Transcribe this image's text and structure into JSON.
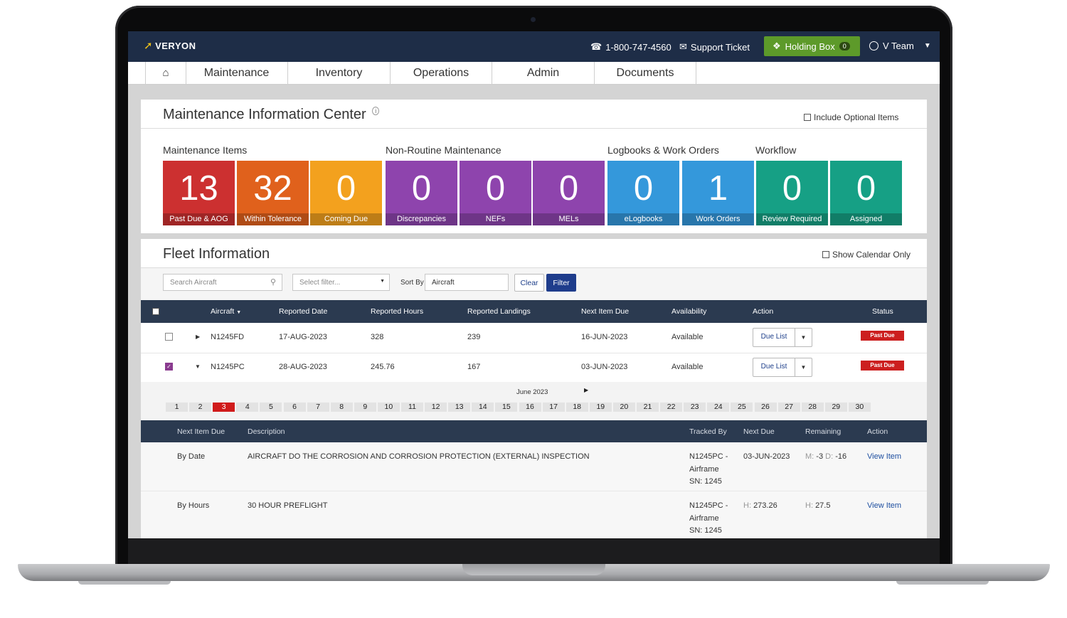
{
  "header": {
    "logo": "VERYON",
    "phone": "1-800-747-4560",
    "support": "Support Ticket",
    "holding_label": "Holding Box",
    "holding_count": "0",
    "user": "V Team"
  },
  "nav": [
    "Maintenance",
    "Inventory",
    "Operations",
    "Admin",
    "Documents"
  ],
  "mic": {
    "title": "Maintenance Information Center",
    "info": "i",
    "include_optional": "Include Optional Items",
    "sections": [
      "Maintenance Items",
      "Non-Routine Maintenance",
      "Logbooks & Work Orders",
      "Workflow"
    ],
    "tiles": [
      {
        "count": "13",
        "label": "Past Due & AOG",
        "color": "#cc3030"
      },
      {
        "count": "32",
        "label": "Within Tolerance",
        "color": "#e0611c"
      },
      {
        "count": "0",
        "label": "Coming Due",
        "color": "#f3a11e"
      },
      {
        "count": "0",
        "label": "Discrepancies",
        "color": "#8e44ad"
      },
      {
        "count": "0",
        "label": "NEFs",
        "color": "#8e44ad"
      },
      {
        "count": "0",
        "label": "MELs",
        "color": "#8e44ad"
      },
      {
        "count": "0",
        "label": "eLogbooks",
        "color": "#3498db"
      },
      {
        "count": "1",
        "label": "Work Orders",
        "color": "#3498db"
      },
      {
        "count": "0",
        "label": "Review Required",
        "color": "#16a085"
      },
      {
        "count": "0",
        "label": "Assigned",
        "color": "#16a085"
      }
    ]
  },
  "fleet": {
    "title": "Fleet Information",
    "show_calendar": "Show Calendar Only",
    "search_placeholder": "Search Aircraft",
    "filter_placeholder": "Select filter...",
    "sort_label": "Sort By",
    "sort_value": "Aircraft",
    "clear": "Clear",
    "filter": "Filter",
    "columns": [
      "Aircraft",
      "Reported Date",
      "Reported Hours",
      "Reported Landings",
      "Next Item Due",
      "Availability",
      "Action",
      "Status"
    ],
    "rows": [
      {
        "aircraft": "N1245FD",
        "date": "17-AUG-2023",
        "hours": "328",
        "landings": "239",
        "next_due": "16-JUN-2023",
        "availability": "Available",
        "action": "Due List",
        "status": "Past Due",
        "checked": false
      },
      {
        "aircraft": "N1245PC",
        "date": "28-AUG-2023",
        "hours": "245.76",
        "landings": "167",
        "next_due": "03-JUN-2023",
        "availability": "Available",
        "action": "Due List",
        "status": "Past Due",
        "checked": true
      }
    ],
    "calendar": {
      "month": "June 2023",
      "days": [
        "1",
        "2",
        "3",
        "4",
        "5",
        "6",
        "7",
        "8",
        "9",
        "10",
        "11",
        "12",
        "13",
        "14",
        "15",
        "16",
        "17",
        "18",
        "19",
        "20",
        "21",
        "22",
        "23",
        "24",
        "25",
        "26",
        "27",
        "28",
        "29",
        "30"
      ],
      "selected": "3"
    },
    "detail": {
      "columns": [
        "Next Item Due",
        "Description",
        "Tracked By",
        "Next Due",
        "Remaining",
        "Action"
      ],
      "rows": [
        {
          "type": "By Date",
          "desc": "AIRCRAFT DO THE CORROSION AND CORROSION PROTECTION (EXTERNAL) INSPECTION",
          "tracked": [
            "N1245PC -",
            "Airframe",
            "SN: 1245"
          ],
          "next_due": "03-JUN-2023",
          "rem_a_label": "M:",
          "rem_a": "-3",
          "rem_b_label": "D:",
          "rem_b": "-16",
          "action": "View Item"
        },
        {
          "type": "By Hours",
          "desc": "30 HOUR PREFLIGHT",
          "tracked": [
            "N1245PC -",
            "Airframe",
            "SN: 1245"
          ],
          "next_due_label": "H:",
          "next_due": "273.26",
          "rem_a_label": "H:",
          "rem_a": "27.5",
          "action": "View Item"
        }
      ]
    }
  }
}
